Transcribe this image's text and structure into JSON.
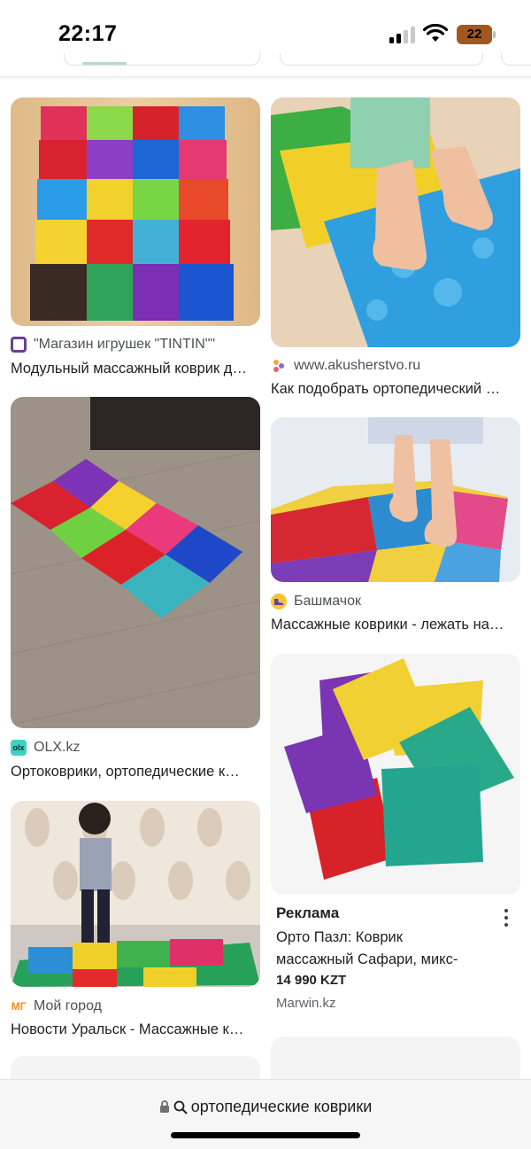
{
  "status_bar": {
    "time": "22:17",
    "battery": "22",
    "battery_color": "#a0581e",
    "icons": [
      "cellular-signal-icon",
      "wifi-icon",
      "battery-icon"
    ]
  },
  "results": [
    {
      "source": "\"Магазин игрушек \"TINTIN\"\"",
      "favicon": "tintin-favicon",
      "favicon_color": "#6a3e9c",
      "title": "Модульный массажный коврик для детей"
    },
    {
      "source": "www.akusherstvo.ru",
      "favicon": "akusherstvo-favicon",
      "title": "Как подобрать ортопедический коврик"
    },
    {
      "source": "OLX.kz",
      "favicon": "olx-favicon",
      "favicon_text": "olx",
      "favicon_color": "#3fd0c4",
      "title": "Ортоковрики, ортопедические коврики"
    },
    {
      "source": "Башмачок",
      "favicon": "bashmachok-favicon",
      "favicon_color": "#6b3f9a",
      "title": "Массажные коврики - лежать на них"
    },
    {
      "source": "Мой город",
      "favicon": "moi-gorod-favicon",
      "favicon_text": "МГ",
      "favicon_color": "#f28b1e",
      "title": "Новости Уральск - Массажные коврики"
    }
  ],
  "ad": {
    "label": "Реклама",
    "title_line1": "Орто Пазл: Коврик",
    "title_line2": "массажный Сафари, микс-",
    "price": "14 990 KZT",
    "domain": "Marwin.kz"
  },
  "address_bar": {
    "query": "ортопедические коврики",
    "icons": [
      "lock-icon",
      "search-icon"
    ]
  }
}
